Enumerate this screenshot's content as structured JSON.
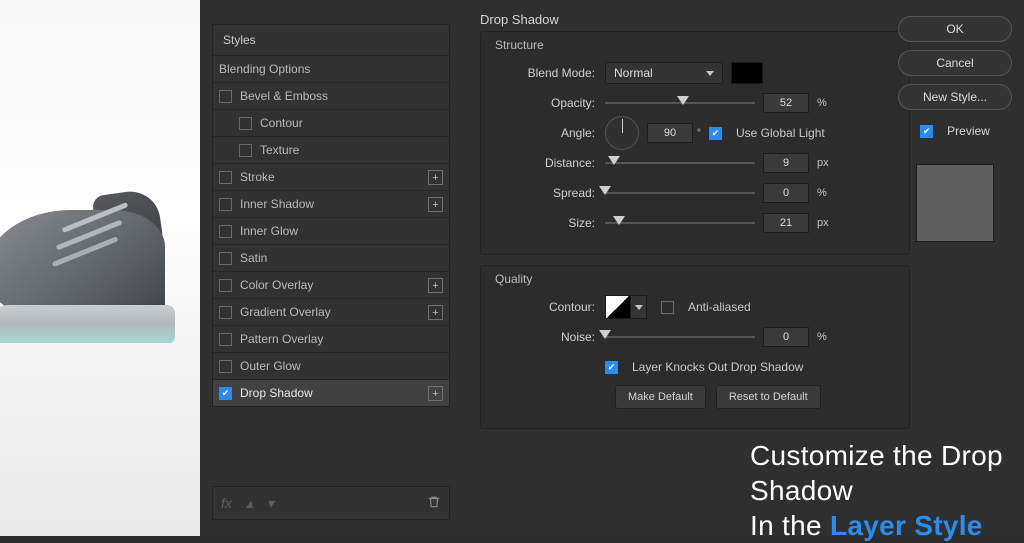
{
  "dialog_title": "Drop Shadow",
  "styles": {
    "header": "Styles",
    "blending_options": "Blending Options",
    "bevel": "Bevel & Emboss",
    "contour": "Contour",
    "texture": "Texture",
    "stroke": "Stroke",
    "inner_shadow": "Inner Shadow",
    "inner_glow": "Inner Glow",
    "satin": "Satin",
    "color_overlay": "Color Overlay",
    "gradient_overlay": "Gradient Overlay",
    "pattern_overlay": "Pattern Overlay",
    "outer_glow": "Outer Glow",
    "drop_shadow": "Drop Shadow"
  },
  "structure": {
    "legend": "Structure",
    "blend_mode_label": "Blend Mode:",
    "blend_mode_value": "Normal",
    "opacity_label": "Opacity:",
    "opacity_value": "52",
    "opacity_pct": 52,
    "angle_label": "Angle:",
    "angle_value": "90",
    "use_global_label": "Use Global Light",
    "distance_label": "Distance:",
    "distance_value": "9",
    "distance_pct": 6,
    "spread_label": "Spread:",
    "spread_value": "0",
    "spread_pct": 0,
    "size_label": "Size:",
    "size_value": "21",
    "size_pct": 9
  },
  "quality": {
    "legend": "Quality",
    "contour_label": "Contour:",
    "anti_label": "Anti-aliased",
    "noise_label": "Noise:",
    "noise_value": "0",
    "noise_pct": 0,
    "knock_label": "Layer Knocks Out Drop Shadow",
    "make_default": "Make Default",
    "reset_default": "Reset to Default"
  },
  "right": {
    "ok": "OK",
    "cancel": "Cancel",
    "new_style": "New Style...",
    "preview": "Preview"
  },
  "caption": {
    "line1": "Customize the Drop Shadow",
    "line2_a": "In the ",
    "line2_b": "Layer Style"
  },
  "units": {
    "pct": "%",
    "px": "px",
    "deg": "°"
  },
  "footer": {
    "fx": "fx"
  }
}
